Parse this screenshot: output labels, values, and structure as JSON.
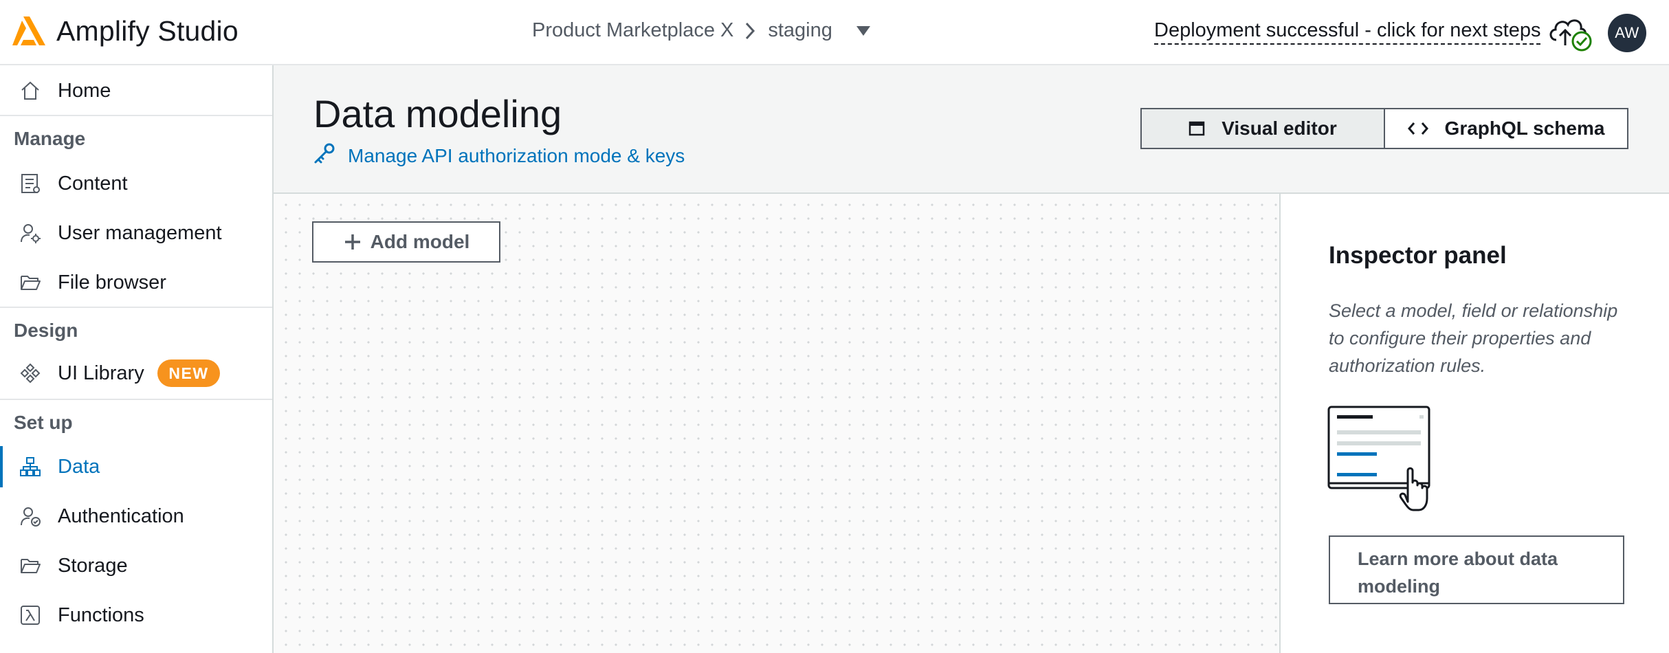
{
  "header": {
    "app_title": "Amplify Studio",
    "logo_icon": "amplify-logo",
    "breadcrumb": {
      "app_name": "Product Marketplace X",
      "environment": "staging"
    },
    "deploy_status": "Deployment successful - click for next steps",
    "avatar_initials": "AW"
  },
  "sidebar": {
    "home": "Home",
    "sections": {
      "manage": "Manage",
      "design": "Design",
      "setup": "Set up"
    },
    "items": {
      "content": "Content",
      "user_management": "User management",
      "file_browser": "File browser",
      "ui_library": "UI Library",
      "ui_library_badge": "NEW",
      "data": "Data",
      "authentication": "Authentication",
      "storage": "Storage",
      "functions": "Functions"
    },
    "active_item": "Data"
  },
  "main": {
    "title": "Data modeling",
    "api_link": "Manage API authorization mode & keys",
    "view_toggle": {
      "visual": "Visual editor",
      "graphql": "GraphQL schema",
      "selected": "Visual editor"
    },
    "add_model": "Add model"
  },
  "inspector": {
    "title": "Inspector panel",
    "description": "Select a model, field or relationship to configure their properties and authorization rules.",
    "learn_more": "Learn more about data modeling"
  },
  "colors": {
    "accent": "#0073bb",
    "badge": "#f7931e",
    "logo": "#ff9900",
    "success": "#1d8102",
    "avatar_bg": "#232f3e"
  }
}
